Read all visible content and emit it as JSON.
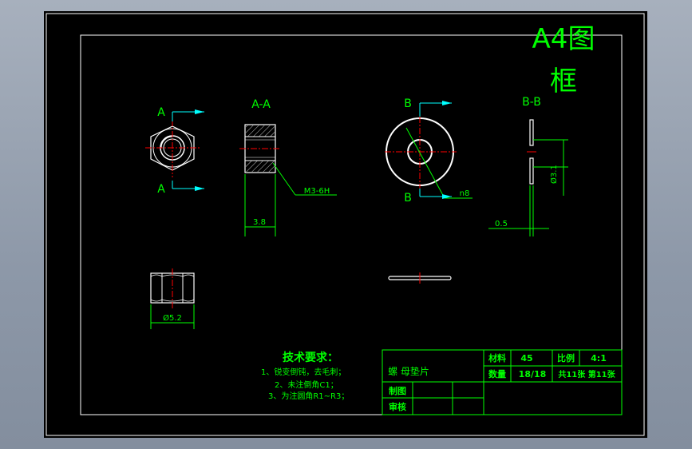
{
  "title_block_corner": {
    "line1": "A4图",
    "line2": "框"
  },
  "views": {
    "hex_section_mark_top": "A",
    "hex_section_mark_bottom": "A",
    "section_view_label": "A-A",
    "thread_callout": "M3-6H",
    "nut_height_dim": "3.8",
    "washer_section_mark_top": "B",
    "washer_section_mark_bottom": "B",
    "washer_od_dim": "n8",
    "washer_section_label": "B-B",
    "washer_id_dim": "Ø3.1",
    "washer_thickness_dim": "0.5",
    "hex_width_dim": "Ø5.2"
  },
  "tech_requirements": {
    "heading": "技术要求：",
    "item1": "1、锐变倒钝，去毛刺；",
    "item2": "2、未注倒角C1；",
    "item3": "3、为注圆角R1~R3；"
  },
  "title_block": {
    "part_name": "螺 母垫片",
    "material_label": "材料",
    "material_value": "45",
    "scale_label": "比例",
    "scale_value": "4:1",
    "qty_label": "数量",
    "qty_value": "18/18",
    "sheets": "共11张 第11张",
    "drawn_label": "制图",
    "checked_label": "审核"
  },
  "colors": {
    "background": "#000000",
    "frame": "#ffffff",
    "text": "#00ff00",
    "dim_arrow": "#00ffff",
    "centerline": "#ff0000",
    "part": "#ffffff"
  }
}
